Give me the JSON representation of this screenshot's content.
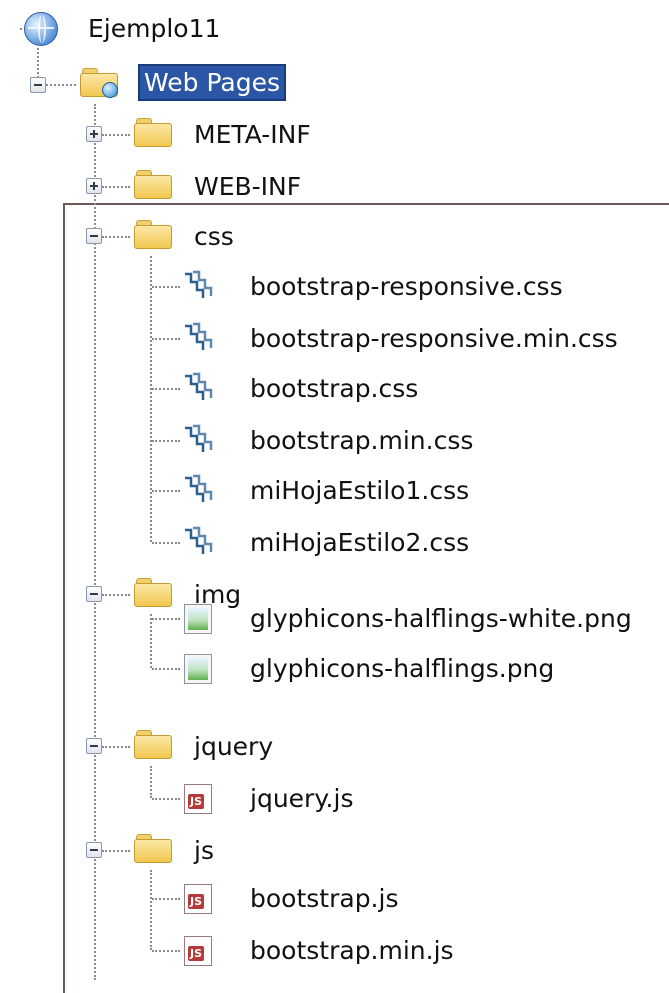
{
  "tree": {
    "root": {
      "label": "Ejemplo11",
      "icon": "globe-icon"
    },
    "web_pages": {
      "label": "Web Pages",
      "icon": "web-pages-folder-icon",
      "selected": true
    },
    "meta_inf": {
      "label": "META-INF",
      "icon": "folder-icon",
      "state": "collapsed"
    },
    "web_inf": {
      "label": "WEB-INF",
      "icon": "folder-icon",
      "state": "collapsed"
    },
    "css": {
      "label": "css",
      "icon": "folder-icon",
      "state": "expanded",
      "files": [
        "bootstrap-responsive.css",
        "bootstrap-responsive.min.css",
        "bootstrap.css",
        "bootstrap.min.css",
        "miHojaEstilo1.css",
        "miHojaEstilo2.css"
      ]
    },
    "img": {
      "label": "img",
      "icon": "folder-icon",
      "state": "expanded",
      "files": [
        "glyphicons-halflings-white.png",
        "glyphicons-halflings.png"
      ]
    },
    "jquery": {
      "label": "jquery",
      "icon": "folder-icon",
      "state": "expanded",
      "files": [
        "jquery.js"
      ]
    },
    "js": {
      "label": "js",
      "icon": "folder-icon",
      "state": "expanded",
      "files": [
        "bootstrap.js",
        "bootstrap.min.js"
      ]
    },
    "js_icon_text": "JS"
  },
  "colors": {
    "selection": "#2b56a6",
    "frame": "#6b5a58"
  }
}
